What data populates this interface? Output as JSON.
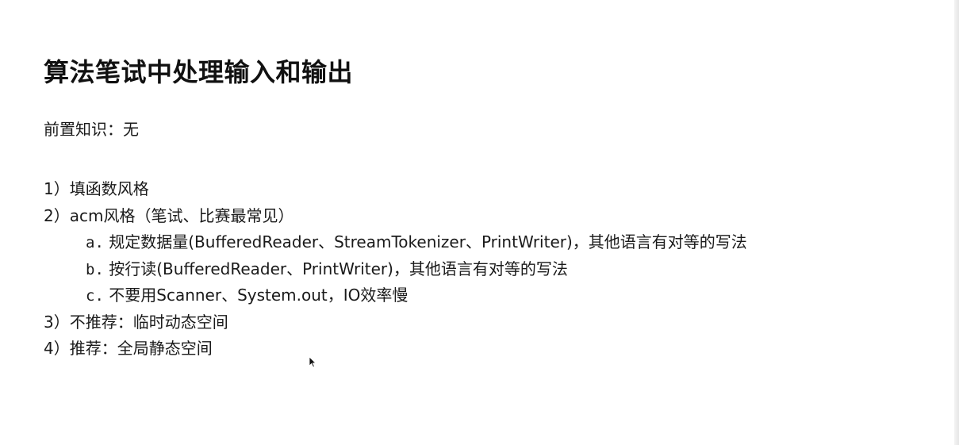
{
  "title": "算法笔试中处理输入和输出",
  "prereq": "前置知识：无",
  "items": [
    {
      "num": "1）",
      "text": "填函数风格"
    },
    {
      "num": "2）",
      "text": "acm风格（笔试、比赛最常见）"
    },
    {
      "num": "3）",
      "text": "不推荐：临时动态空间"
    },
    {
      "num": "4）",
      "text": "推荐：全局静态空间"
    }
  ],
  "subitems": [
    {
      "marker": "a.",
      "text": "规定数据量(BufferedReader、StreamTokenizer、PrintWriter)，其他语言有对等的写法"
    },
    {
      "marker": "b.",
      "text": "按行读(BufferedReader、PrintWriter)，其他语言有对等的写法"
    },
    {
      "marker": "c.",
      "text": "不要用Scanner、System.out，IO效率慢"
    }
  ],
  "icons": {
    "cursor": "mouse-pointer-icon"
  }
}
